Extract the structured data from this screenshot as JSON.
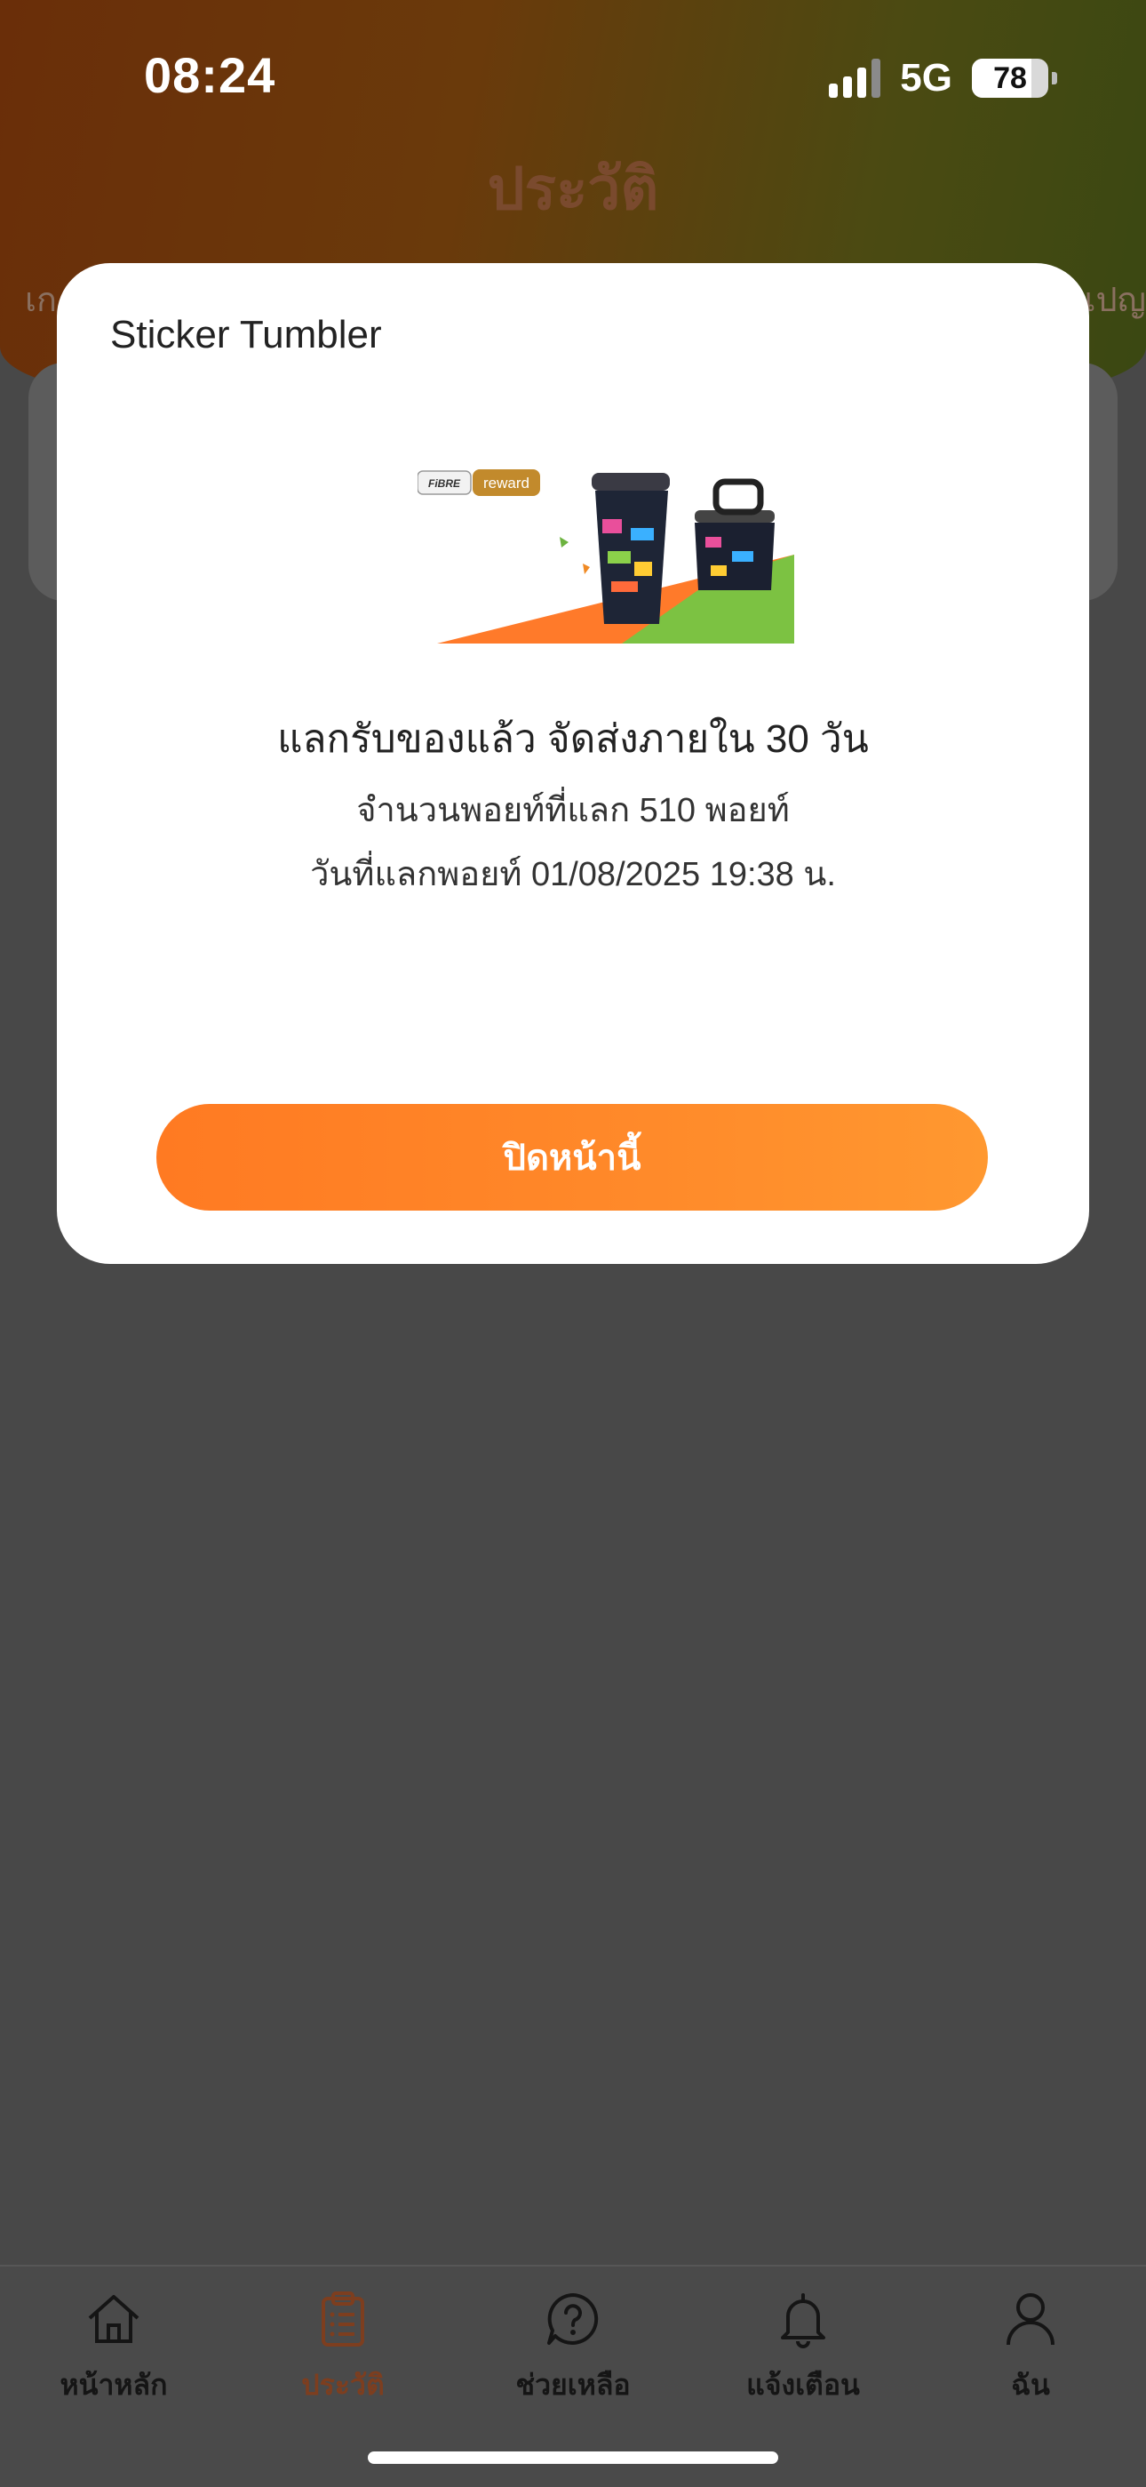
{
  "status_bar": {
    "time": "08:24",
    "network": "5G",
    "battery": "78",
    "battery_level": 0.78
  },
  "header": {
    "title": "ประวัติ",
    "tab_peek_left": "เก",
    "tab_peek_right": "เปญ"
  },
  "modal": {
    "title": "Sticker Tumbler",
    "image": {
      "brand": "FiBRE",
      "badge": "reward"
    },
    "message": "แลกรับของแล้ว จัดส่งภายใน 30 วัน",
    "points_line": "จำนวนพอยท์ที่แลก 510 พอยท์",
    "date_line": "วันที่แลกพอยท์ 01/08/2025 19:38 น.",
    "close_label": "ปิดหน้านี้"
  },
  "nav": {
    "items": [
      {
        "label": "หน้าหลัก",
        "icon": "home-icon"
      },
      {
        "label": "ประวัติ",
        "icon": "history-icon",
        "active": true
      },
      {
        "label": "ช่วยเหลือ",
        "icon": "help-icon"
      },
      {
        "label": "แจ้งเตือน",
        "icon": "bell-icon"
      },
      {
        "label": "ฉัน",
        "icon": "profile-icon"
      }
    ]
  },
  "colors": {
    "accent": "#ff7a22",
    "active_nav": "#7d3e1f",
    "overlay": "#484848"
  }
}
